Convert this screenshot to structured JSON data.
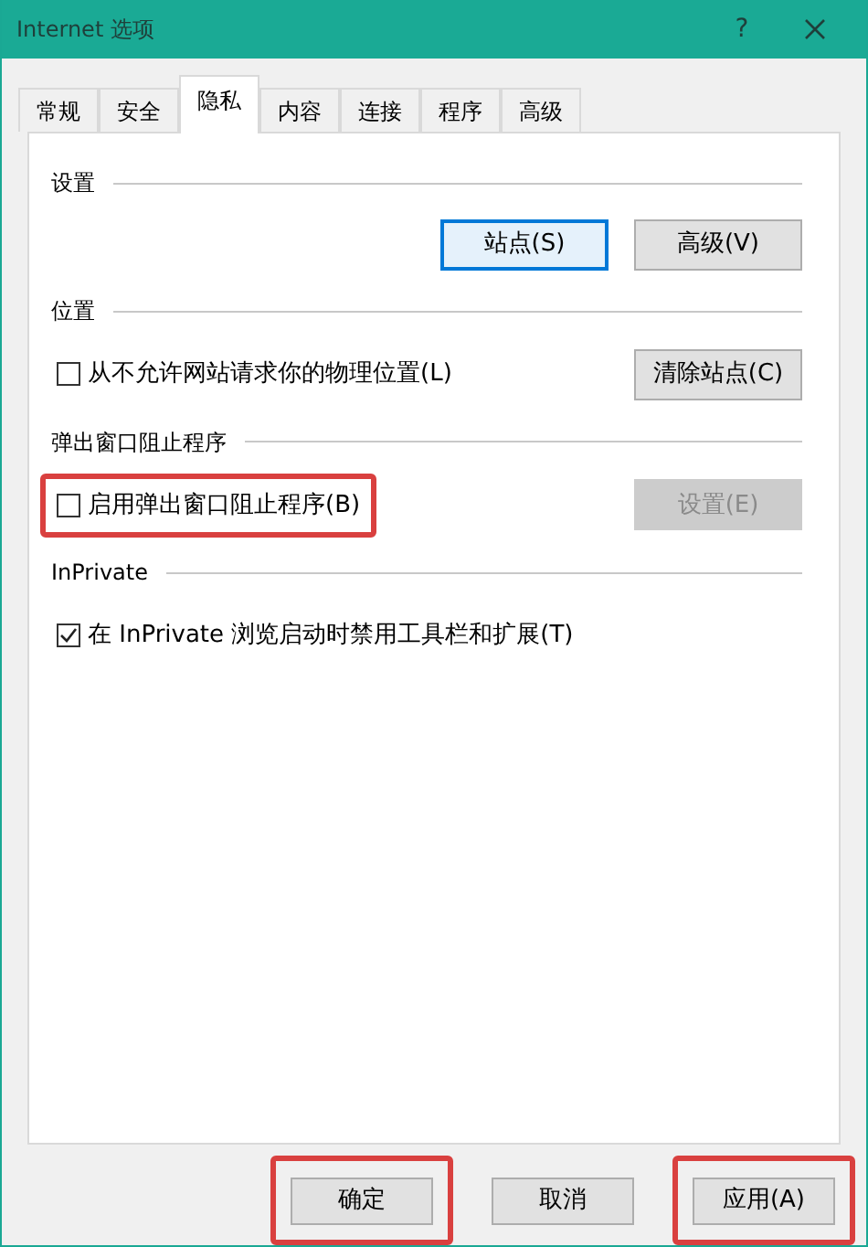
{
  "window": {
    "title": "Internet 选项",
    "help": "?"
  },
  "tabs": [
    {
      "label": "常规",
      "selected": false
    },
    {
      "label": "安全",
      "selected": false
    },
    {
      "label": "隐私",
      "selected": true
    },
    {
      "label": "内容",
      "selected": false
    },
    {
      "label": "连接",
      "selected": false
    },
    {
      "label": "程序",
      "selected": false
    },
    {
      "label": "高级",
      "selected": false
    }
  ],
  "sections": [
    {
      "title": "设置",
      "buttons": [
        {
          "label": "站点(S)",
          "focused": true,
          "disabled": false
        },
        {
          "label": "高级(V)",
          "focused": false,
          "disabled": false
        }
      ]
    },
    {
      "title": "位置",
      "checkbox": {
        "label": "从不允许网站请求你的物理位置(L)",
        "checked": false,
        "highlighted": false
      },
      "buttons": [
        {
          "label": "清除站点(C)",
          "focused": false,
          "disabled": false
        }
      ]
    },
    {
      "title": "弹出窗口阻止程序",
      "checkbox": {
        "label": "启用弹出窗口阻止程序(B)",
        "checked": false,
        "highlighted": true
      },
      "buttons": [
        {
          "label": "设置(E)",
          "focused": false,
          "disabled": true
        }
      ]
    },
    {
      "title": "InPrivate",
      "checkbox": {
        "label": "在 InPrivate 浏览启动时禁用工具栏和扩展(T)",
        "checked": true,
        "highlighted": false
      }
    }
  ],
  "footer_buttons": [
    {
      "label": "确定",
      "highlighted": true
    },
    {
      "label": "取消",
      "highlighted": false
    },
    {
      "label": "应用(A)",
      "highlighted": true
    }
  ]
}
